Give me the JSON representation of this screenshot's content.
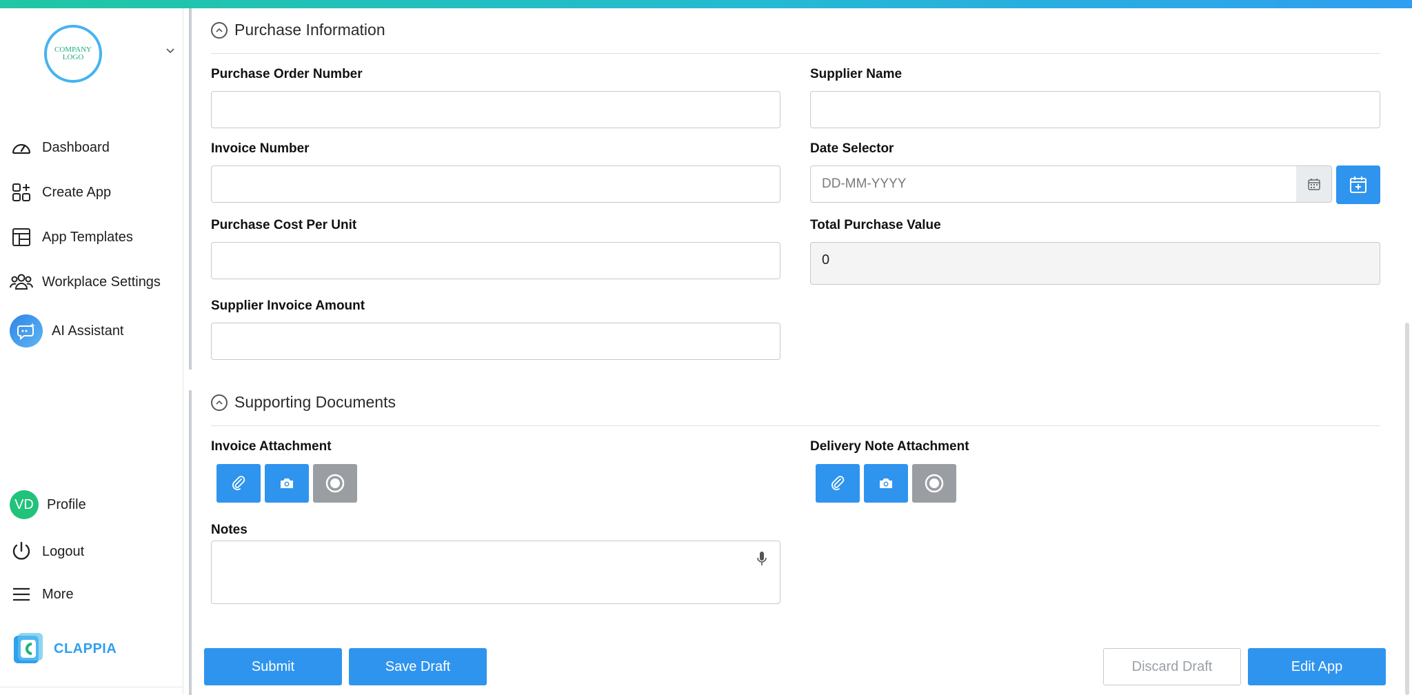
{
  "sidebar": {
    "logo_text": "COMPANY LOGO",
    "items": [
      {
        "label": "Dashboard",
        "icon": "dashboard-icon"
      },
      {
        "label": "Create App",
        "icon": "create-app-icon"
      },
      {
        "label": "App Templates",
        "icon": "templates-icon"
      },
      {
        "label": "Workplace Settings",
        "icon": "users-icon"
      },
      {
        "label": "AI Assistant",
        "icon": "ai-assistant-icon"
      }
    ],
    "profile": {
      "initials": "VD",
      "label": "Profile"
    },
    "logout_label": "Logout",
    "more_label": "More",
    "brand": "CLAPPIA"
  },
  "sections": {
    "purchase": "Purchase Information",
    "documents": "Supporting Documents"
  },
  "fields": {
    "po_number": {
      "label": "Purchase Order Number",
      "value": ""
    },
    "supplier_name": {
      "label": "Supplier Name",
      "value": ""
    },
    "invoice_number": {
      "label": "Invoice Number",
      "value": ""
    },
    "date_selector": {
      "label": "Date Selector",
      "placeholder": "DD-MM-YYYY"
    },
    "cost_per_unit": {
      "label": "Purchase Cost Per Unit",
      "value": ""
    },
    "total_value": {
      "label": "Total Purchase Value",
      "value": "0"
    },
    "supplier_invoice": {
      "label": "Supplier Invoice Amount",
      "value": ""
    },
    "invoice_attachment": {
      "label": "Invoice Attachment"
    },
    "delivery_attachment": {
      "label": "Delivery Note Attachment"
    },
    "notes": {
      "label": "Notes",
      "value": ""
    }
  },
  "actions": {
    "submit": "Submit",
    "save_draft": "Save Draft",
    "discard_draft": "Discard Draft",
    "edit_app": "Edit App"
  },
  "colors": {
    "accent": "#2f94ee",
    "avatar": "#21c27a",
    "disabled": "#9a9ea3"
  }
}
